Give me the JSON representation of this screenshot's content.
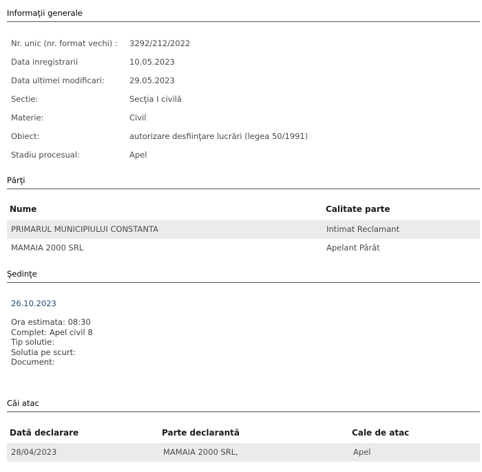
{
  "sections": {
    "general": "Informaţii generale",
    "parties": "Părţi",
    "hearings": "Şedinţe",
    "appeals": "Căi atac"
  },
  "general_info": [
    {
      "label": "Nr. unic (nr. format vechi) :",
      "value": "3292/212/2022"
    },
    {
      "label": "Data inregistrarii",
      "value": "10.05.2023"
    },
    {
      "label": "Data ultimei modificari:",
      "value": "29.05.2023"
    },
    {
      "label": "Sectie:",
      "value": "Secţia I civilă"
    },
    {
      "label": "Materie:",
      "value": "Civil"
    },
    {
      "label": "Obiect:",
      "value": "autorizare desfiinţare lucrări (legea 50/1991)"
    },
    {
      "label": "Stadiu procesual:",
      "value": "Apel"
    }
  ],
  "parties": {
    "headers": [
      "Nume",
      "Calitate parte"
    ],
    "rows": [
      [
        "PRIMARUL MUNICIPIULUI CONSTANTA",
        "Intimat Reclamant"
      ],
      [
        "MAMAIA 2000 SRL",
        "Apelant Pârât"
      ]
    ]
  },
  "hearings": [
    {
      "date": "26.10.2023",
      "ora": "Ora estimata: 08:30",
      "complet": "Complet: Apel civil 8",
      "tip": "Tip solutie:",
      "solutia": "Solutia pe scurt:",
      "document": "Document:"
    }
  ],
  "appeals": {
    "headers": [
      "Dată declarare",
      "Parte declarantă",
      "Cale de atac"
    ],
    "rows": [
      [
        "28/04/2023",
        "MAMAIA 2000 SRL,",
        "Apel"
      ]
    ]
  },
  "colors": {
    "row_shade": "#ebebeb",
    "date_link": "#1f4e79",
    "rule": "#555555"
  }
}
